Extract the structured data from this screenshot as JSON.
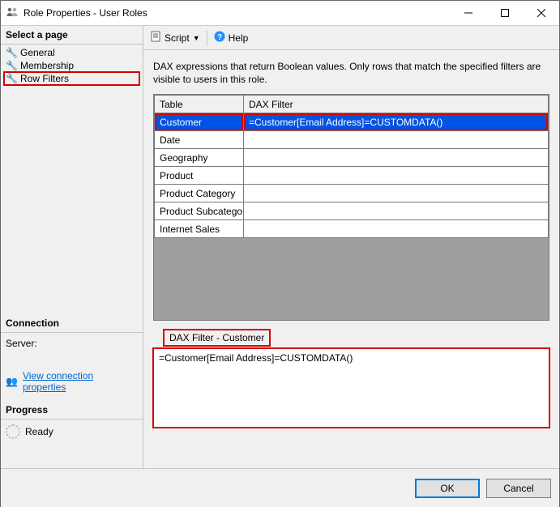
{
  "window": {
    "title": "Role Properties - User Roles"
  },
  "sidebar": {
    "select_page": "Select a page",
    "pages": [
      "General",
      "Membership",
      "Row Filters"
    ],
    "connection_head": "Connection",
    "server_label": "Server:",
    "view_conn_link": "View connection properties",
    "progress_head": "Progress",
    "progress_status": "Ready"
  },
  "toolbar": {
    "script_label": "Script",
    "help_label": "Help"
  },
  "main": {
    "description": "DAX expressions that return Boolean values. Only rows that match the specified filters are visible to users in this role.",
    "columns": {
      "table": "Table",
      "dax": "DAX Filter"
    },
    "rows": [
      {
        "table": "Customer",
        "dax": "=Customer[Email Address]=CUSTOMDATA()"
      },
      {
        "table": "Date",
        "dax": ""
      },
      {
        "table": "Geography",
        "dax": ""
      },
      {
        "table": "Product",
        "dax": ""
      },
      {
        "table": "Product Category",
        "dax": ""
      },
      {
        "table": "Product Subcategory",
        "dax": ""
      },
      {
        "table": "Internet Sales",
        "dax": ""
      }
    ],
    "dax_label": "DAX Filter - Customer",
    "dax_value": "=Customer[Email Address]=CUSTOMDATA()"
  },
  "footer": {
    "ok": "OK",
    "cancel": "Cancel"
  }
}
